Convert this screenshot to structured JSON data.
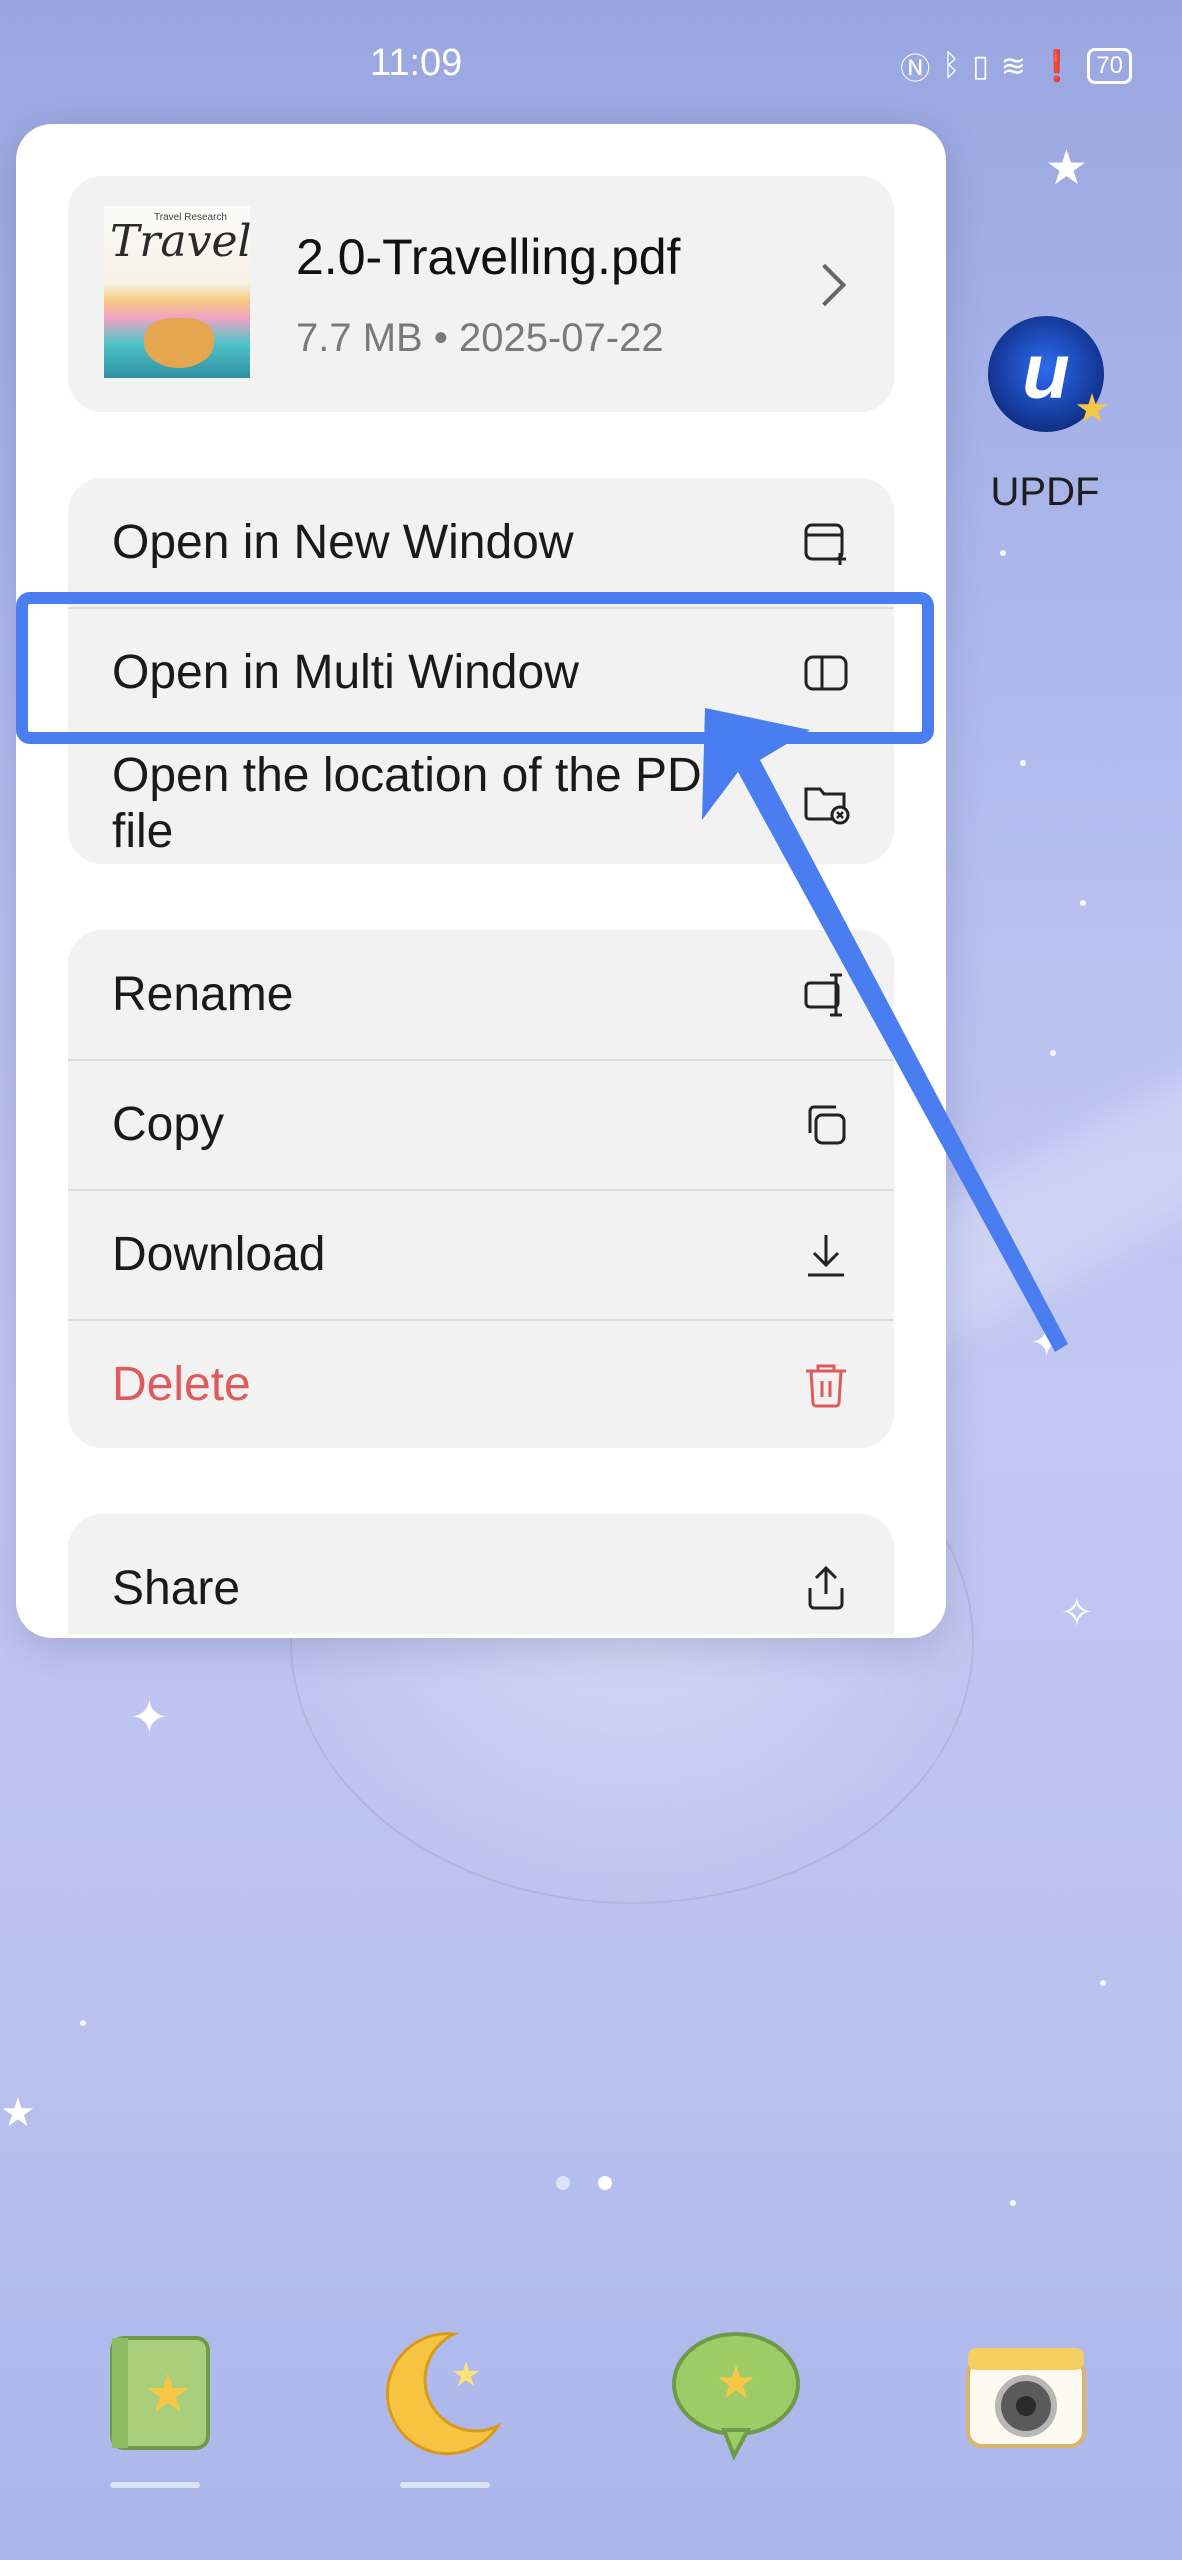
{
  "status_bar": {
    "time": "11:09",
    "battery": "70",
    "icons": [
      "nfc-icon",
      "bluetooth-icon",
      "vibrate-icon",
      "wifi-6-icon",
      "alert-icon",
      "battery-icon"
    ]
  },
  "home": {
    "app_label": "UPDF",
    "app_icon_glyph": "u",
    "dock_apps": [
      "notes-app-icon",
      "moon-app-icon",
      "messages-app-icon",
      "camera-app-icon"
    ],
    "page_indicator": {
      "pages": 2,
      "active": 2
    }
  },
  "context_menu": {
    "file": {
      "name": "2.0-Travelling.pdf",
      "meta": "7.7 MB • 2025-07-22",
      "thumbnail_title": "Travel",
      "thumbnail_subtitle": "Travel Research"
    },
    "group1": [
      {
        "label": "Open in New Window",
        "icon": "new-window-icon"
      },
      {
        "label": "Open in Multi Window",
        "icon": "split-window-icon",
        "highlighted": true
      },
      {
        "label": "Open the location of the PDF file",
        "icon": "folder-location-icon"
      }
    ],
    "group2": [
      {
        "label": "Rename",
        "icon": "rename-icon"
      },
      {
        "label": "Copy",
        "icon": "copy-icon"
      },
      {
        "label": "Download",
        "icon": "download-icon"
      },
      {
        "label": "Delete",
        "icon": "trash-icon",
        "danger": true
      }
    ],
    "group3": [
      {
        "label": "Share",
        "icon": "share-icon"
      }
    ]
  },
  "annotation": {
    "highlight_color": "#4a7df0"
  },
  "colors": {
    "danger": "#de5b5b",
    "accent": "#4a7df0"
  }
}
